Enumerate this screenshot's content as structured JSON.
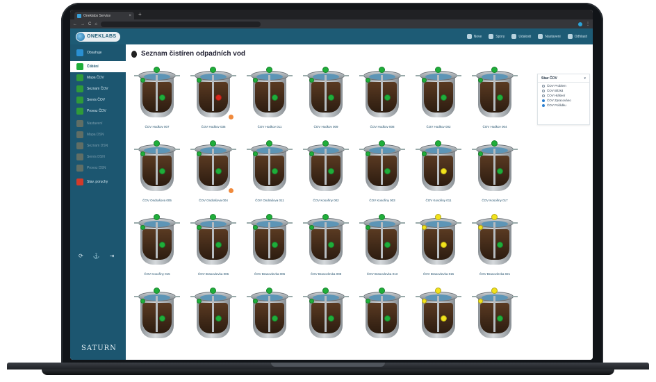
{
  "browser": {
    "tab_title": "Oneklabs Service",
    "tab_close": "×",
    "new_tab": "+",
    "nav": [
      "←",
      "→",
      "C",
      "⌂"
    ],
    "url": "",
    "ext_glyph": "⋮"
  },
  "app": {
    "logo_text": "ONEKLABS",
    "topnav": [
      "Nove",
      "Spory",
      "Udalosti",
      "Nastaveni",
      "Odhlasit"
    ]
  },
  "sidebar": {
    "items": [
      {
        "label": "Obsahuje",
        "icon": "monitor-icon",
        "state": "normal"
      },
      {
        "label": "Čištění",
        "icon": "drop-icon",
        "state": "active"
      },
      {
        "label": "Mapa ČOV",
        "icon": "map-icon",
        "state": "normal"
      },
      {
        "label": "Seznam ČOV",
        "icon": "list-icon",
        "state": "normal"
      },
      {
        "label": "Servis ČOV",
        "icon": "wrench-icon",
        "state": "normal"
      },
      {
        "label": "Provoz ČOV",
        "icon": "gauge-icon",
        "state": "normal"
      },
      {
        "label": "Nastavení",
        "icon": "gear-icon",
        "state": "dim"
      },
      {
        "label": "Mapa DSN",
        "icon": "map-icon",
        "state": "dim"
      },
      {
        "label": "Seznam DSN",
        "icon": "list-icon",
        "state": "dim"
      },
      {
        "label": "Servis DSN",
        "icon": "wrench-icon",
        "state": "dim"
      },
      {
        "label": "Provoz DSN",
        "icon": "gauge-icon",
        "state": "dim"
      },
      {
        "label": "Stav. poruchy",
        "icon": "alert-icon",
        "state": "normal"
      }
    ],
    "tools": [
      "⟳",
      "⚓",
      "⇥"
    ],
    "brand": "SATURN"
  },
  "main": {
    "title": "Seznam čistíren odpadních vod"
  },
  "filter": {
    "title": "Stav ČOV",
    "caret": "▾",
    "options": [
      {
        "label": "ČOV Problem",
        "checked": false
      },
      {
        "label": "ČOV Blízká",
        "checked": false
      },
      {
        "label": "ČOV Hlášení",
        "checked": false
      },
      {
        "label": "ČOV Zpracováno",
        "checked": true
      },
      {
        "label": "ČOV Pořádku",
        "checked": true
      }
    ]
  },
  "colors": {
    "green": "#1fae3a",
    "red": "#d8281d",
    "yellow": "#f2e21c",
    "brand": "#1d5b75"
  },
  "tanks": [
    {
      "label": "ČOV Hodkov 007",
      "top": "green",
      "mid": "green",
      "side": "green",
      "alert": false
    },
    {
      "label": "ČOV Hodkov 036",
      "top": "green",
      "mid": "red",
      "side": "green",
      "alert": true
    },
    {
      "label": "ČOV Hodkov 011",
      "top": "green",
      "mid": "green",
      "side": "green",
      "alert": false
    },
    {
      "label": "ČOV Hodkov 009",
      "top": "green",
      "mid": "green",
      "side": "green",
      "alert": false
    },
    {
      "label": "ČOV Hodkov 008",
      "top": "green",
      "mid": "green",
      "side": "green",
      "alert": false
    },
    {
      "label": "ČOV Hodkov 002",
      "top": "green",
      "mid": "green",
      "side": "green",
      "alert": false
    },
    {
      "label": "ČOV Hodkov 004",
      "top": "green",
      "mid": "green",
      "side": "green",
      "alert": false
    },
    {
      "label": "ČOV Ondrašova 005",
      "top": "green",
      "mid": "green",
      "side": "green",
      "alert": false
    },
    {
      "label": "ČOV Ondrašova 004",
      "top": "green",
      "mid": "green",
      "side": "green",
      "alert": true
    },
    {
      "label": "ČOV Ondrašova 011",
      "top": "green",
      "mid": "green",
      "side": "green",
      "alert": false
    },
    {
      "label": "ČOV Kosořiny 002",
      "top": "green",
      "mid": "green",
      "side": "green",
      "alert": false
    },
    {
      "label": "ČOV Kosořiny 003",
      "top": "green",
      "mid": "green",
      "side": "green",
      "alert": false
    },
    {
      "label": "ČOV Kosořiny 011",
      "top": "green",
      "mid": "yellow",
      "side": "green",
      "alert": false
    },
    {
      "label": "ČOV Kosořiny 017",
      "top": "green",
      "mid": "green",
      "side": "green",
      "alert": false
    },
    {
      "label": "ČOV Kosořiny 015",
      "top": "green",
      "mid": "green",
      "side": "green",
      "alert": false
    },
    {
      "label": "ČOV Brasovlevka 006",
      "top": "green",
      "mid": "green",
      "side": "green",
      "alert": false
    },
    {
      "label": "ČOV Brasovlevka 006",
      "top": "green",
      "mid": "green",
      "side": "green",
      "alert": false
    },
    {
      "label": "ČOV Brasovlevka 008",
      "top": "green",
      "mid": "green",
      "side": "green",
      "alert": false
    },
    {
      "label": "ČOV Brasovlevka 013",
      "top": "green",
      "mid": "green",
      "side": "green",
      "alert": false
    },
    {
      "label": "ČOV Brasovlevka 015",
      "top": "yellow",
      "mid": "yellow",
      "side": "yellow",
      "alert": false
    },
    {
      "label": "ČOV Brasovlevka 021",
      "top": "yellow",
      "mid": "green",
      "side": "yellow",
      "alert": false
    },
    {
      "label": "",
      "top": "green",
      "mid": "green",
      "side": "green",
      "alert": false
    },
    {
      "label": "",
      "top": "green",
      "mid": "green",
      "side": "green",
      "alert": false
    },
    {
      "label": "",
      "top": "green",
      "mid": "green",
      "side": "green",
      "alert": false
    },
    {
      "label": "",
      "top": "green",
      "mid": "green",
      "side": "green",
      "alert": false
    },
    {
      "label": "",
      "top": "green",
      "mid": "green",
      "side": "green",
      "alert": false
    },
    {
      "label": "",
      "top": "yellow",
      "mid": "yellow",
      "side": "yellow",
      "alert": false
    },
    {
      "label": "",
      "top": "yellow",
      "mid": "green",
      "side": "yellow",
      "alert": false
    }
  ]
}
